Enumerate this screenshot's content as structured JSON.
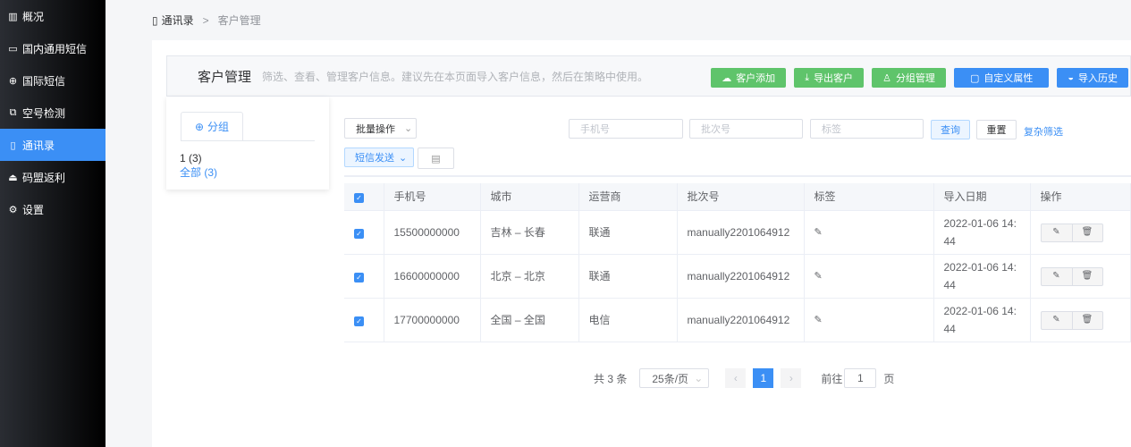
{
  "sidebar": {
    "items": [
      {
        "label": "概况",
        "icon": "chart-icon"
      },
      {
        "label": "国内通用短信",
        "icon": "message-icon"
      },
      {
        "label": "国际短信",
        "icon": "globe-icon"
      },
      {
        "label": "空号检测",
        "icon": "check-copy-icon"
      },
      {
        "label": "通讯录",
        "icon": "contacts-icon",
        "active": true
      },
      {
        "label": "码盟返利",
        "icon": "bag-icon"
      },
      {
        "label": "设置",
        "icon": "gear-icon"
      }
    ]
  },
  "breadcrumb": {
    "root": "通讯录",
    "sep": ">",
    "current": "客户管理"
  },
  "header": {
    "title": "客户管理",
    "desc": "筛选、查看、管理客户信息。建议先在本页面导入客户信息，然后在策略中使用。",
    "buttons": [
      "客户添加",
      "导出客户",
      "分组管理",
      "自定义属性",
      "导入历史"
    ]
  },
  "groups": {
    "tab": "分组",
    "items": [
      "1 (3)",
      "全部 (3)"
    ]
  },
  "toolbar": {
    "batch": "批量操作",
    "sms": "短信发送",
    "phone_ph": "手机号",
    "batch_ph": "批次号",
    "tag_ph": "标签",
    "query": "查询",
    "reset": "重置",
    "advanced": "复杂筛选"
  },
  "table": {
    "headers": [
      "手机号",
      "城市",
      "运营商",
      "批次号",
      "标签",
      "导入日期",
      "操作"
    ],
    "rows": [
      {
        "phone": "15500000000",
        "city": "吉林 – 长春",
        "carrier": "联通",
        "batch": "manually2201064912",
        "date": "2022-01-06 14:44"
      },
      {
        "phone": "16600000000",
        "city": "北京 – 北京",
        "carrier": "联通",
        "batch": "manually2201064912",
        "date": "2022-01-06 14:44"
      },
      {
        "phone": "17700000000",
        "city": "全国 – 全国",
        "carrier": "电信",
        "batch": "manually2201064912",
        "date": "2022-01-06 14:44"
      }
    ]
  },
  "pagination": {
    "total": "共 3 条",
    "page_size": "25条/页",
    "current": "1",
    "goto_label": "前往",
    "goto_value": "1",
    "page_unit": "页"
  },
  "colors": {
    "accent": "#3b8ff5",
    "green": "#5fc46b"
  }
}
